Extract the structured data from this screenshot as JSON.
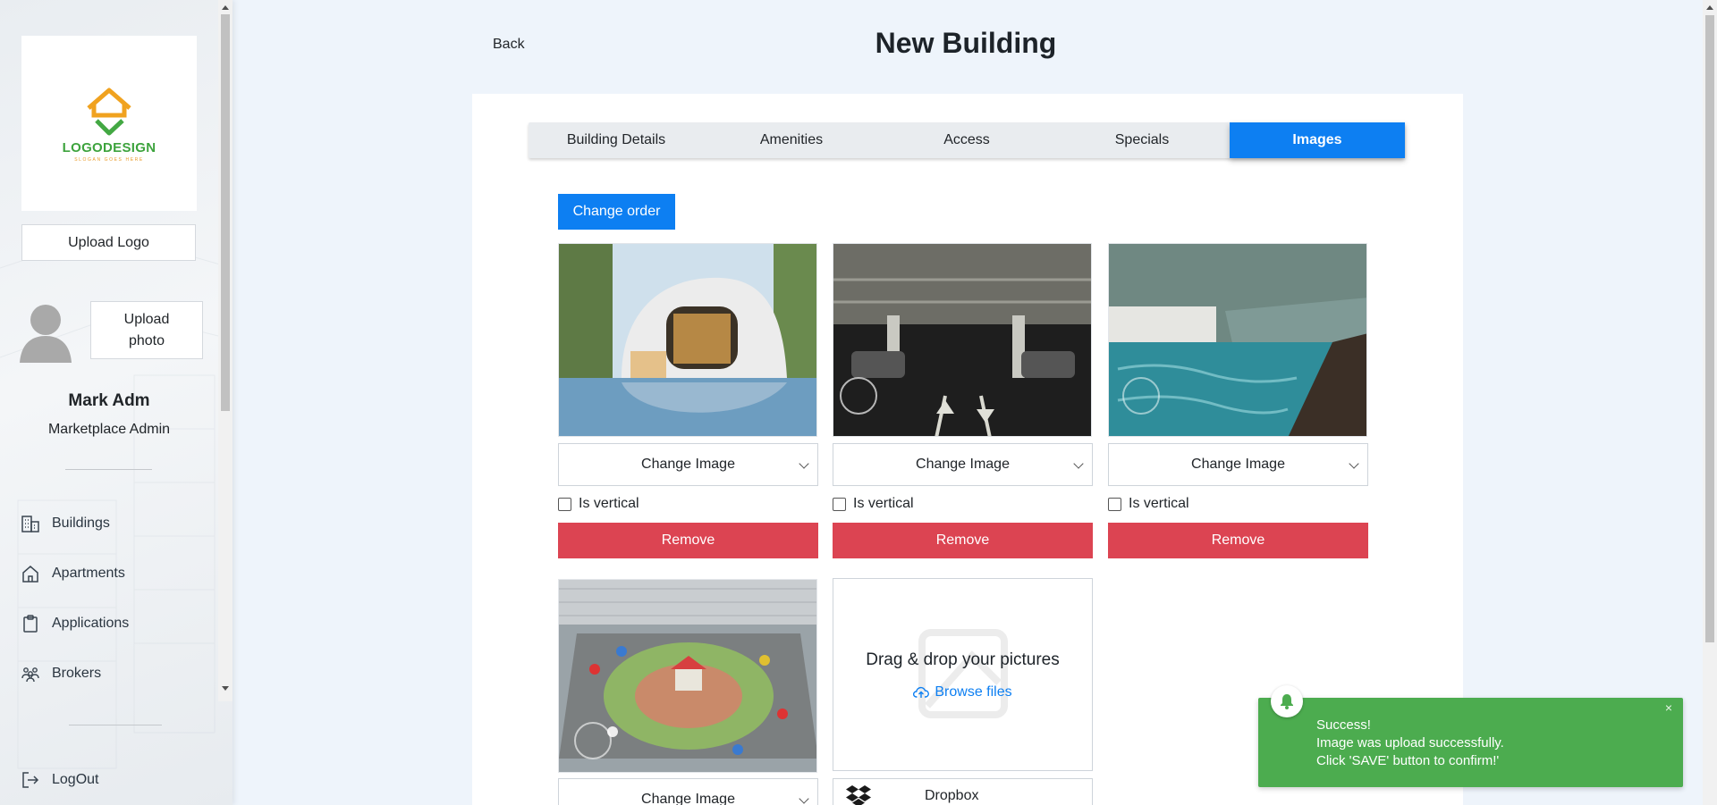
{
  "sidebar": {
    "logo": {
      "text": "LOGODESIGN",
      "subtext": "SLOGAN GOES HERE"
    },
    "upload_logo_label": "Upload Logo",
    "upload_photo_label": "Upload photo",
    "user": {
      "name": "Mark Adm",
      "role": "Marketplace Admin"
    },
    "nav": [
      {
        "label": "Buildings",
        "icon": "buildings-icon"
      },
      {
        "label": "Apartments",
        "icon": "home-icon"
      },
      {
        "label": "Applications",
        "icon": "clipboard-icon"
      },
      {
        "label": "Brokers",
        "icon": "people-icon"
      }
    ],
    "logout_label": "LogOut"
  },
  "header": {
    "back_label": "Back",
    "title": "New Building"
  },
  "tabs": [
    {
      "label": "Building Details",
      "active": false
    },
    {
      "label": "Amenities",
      "active": false
    },
    {
      "label": "Access",
      "active": false
    },
    {
      "label": "Specials",
      "active": false
    },
    {
      "label": "Images",
      "active": true
    }
  ],
  "images": {
    "change_order_label": "Change order",
    "items": [
      {
        "alt": "Modern curved villa with pool",
        "select_label": "Change Image",
        "vertical_label": "Is vertical",
        "remove_label": "Remove"
      },
      {
        "alt": "Underground parking garage",
        "select_label": "Change Image",
        "vertical_label": "Is vertical",
        "remove_label": "Remove"
      },
      {
        "alt": "Rooftop swimming pool",
        "select_label": "Change Image",
        "vertical_label": "Is vertical",
        "remove_label": "Remove"
      },
      {
        "alt": "Courtyard with parking and playground",
        "select_label": "Change Image"
      }
    ],
    "dropzone": {
      "title": "Drag & drop your pictures",
      "browse_label": "Browse files"
    },
    "dropbox_label": "Dropbox"
  },
  "toast": {
    "line1": "Success!",
    "line2": "Image was upload successfully.",
    "line3": "Click 'SAVE' button to confirm!'",
    "close": "×"
  },
  "colors": {
    "primary": "#0d7ff2",
    "danger": "#dc4452",
    "success": "#4cac4f"
  }
}
